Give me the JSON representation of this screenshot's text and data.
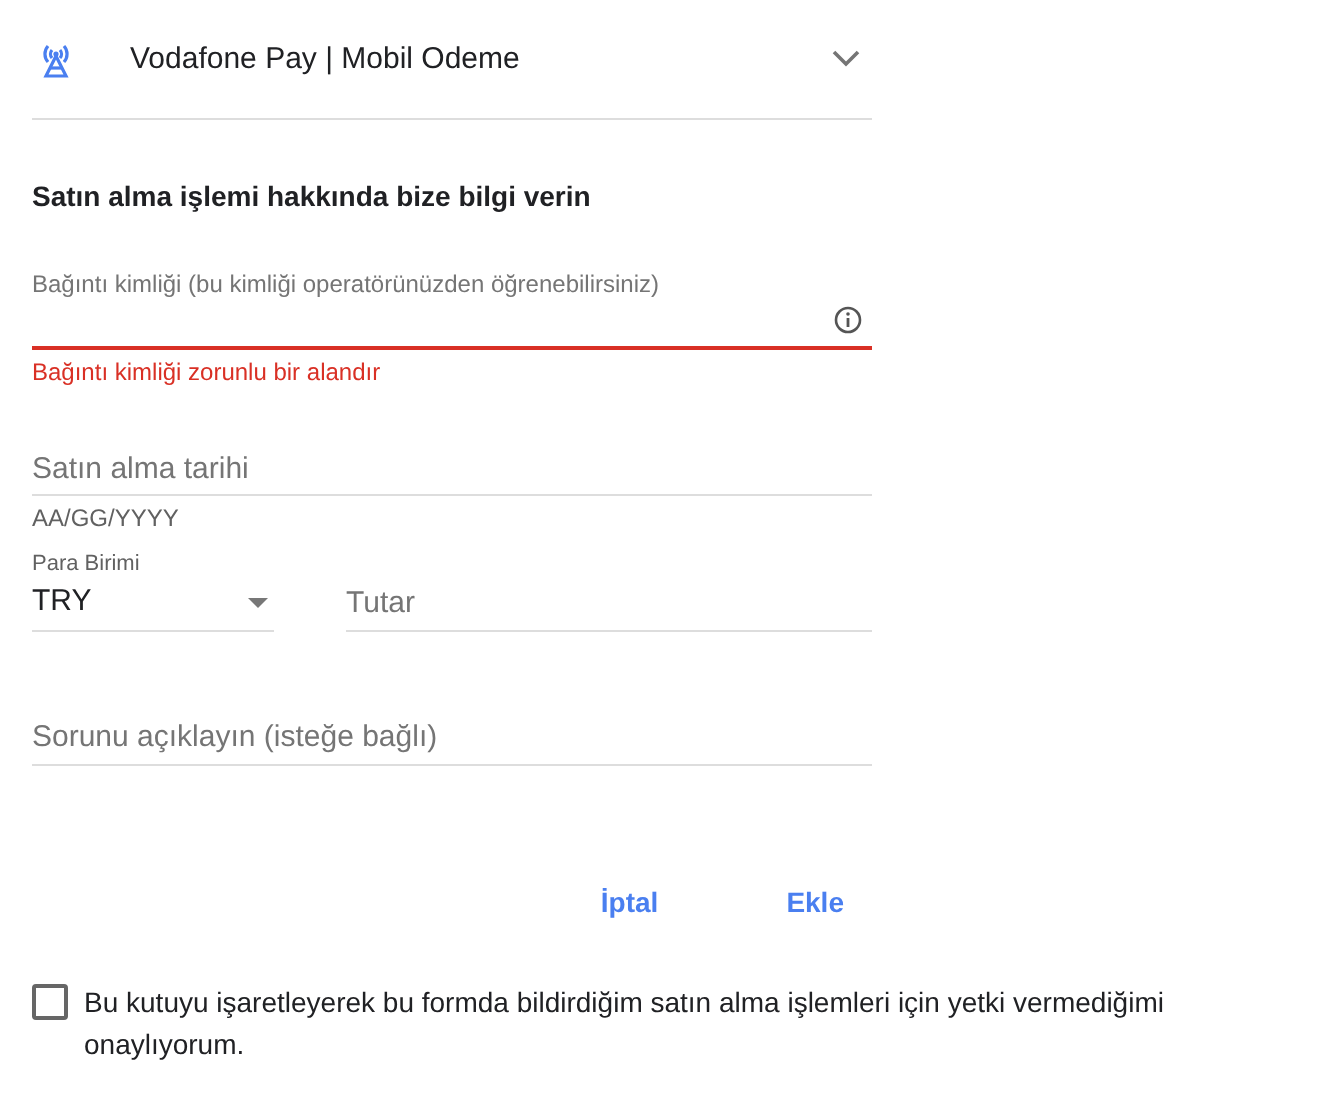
{
  "header": {
    "title": "Vodafone Pay | Mobil Odeme",
    "expanded": false
  },
  "heading": "Satın alma işlemi hakkında bize bilgi verin",
  "fields": [
    {
      "kind": "text",
      "label": "Bağıntı kimliği (bu kimliği operatörünüzden öğrenebilirsiniz)",
      "error": "Bağıntı kimliği zorunlu bir alandır",
      "info": true
    },
    {
      "kind": "text",
      "placeholder": "Satın alma tarihi",
      "hint": "AA/GG/YYYY"
    }
  ],
  "currency": {
    "label": "Para Birimi",
    "value": "TRY"
  },
  "amount": {
    "placeholder": "Tutar"
  },
  "description": {
    "placeholder": "Sorunu açıklayın (isteğe bağlı)"
  },
  "buttons": [
    "İptal",
    "Ekle"
  ],
  "consent": {
    "text": "Bu kutuyu işaretleyerek bu formda bildirdiğim satın alma işlemleri için yetki vermediğimi onaylıyorum.",
    "checked": false
  }
}
